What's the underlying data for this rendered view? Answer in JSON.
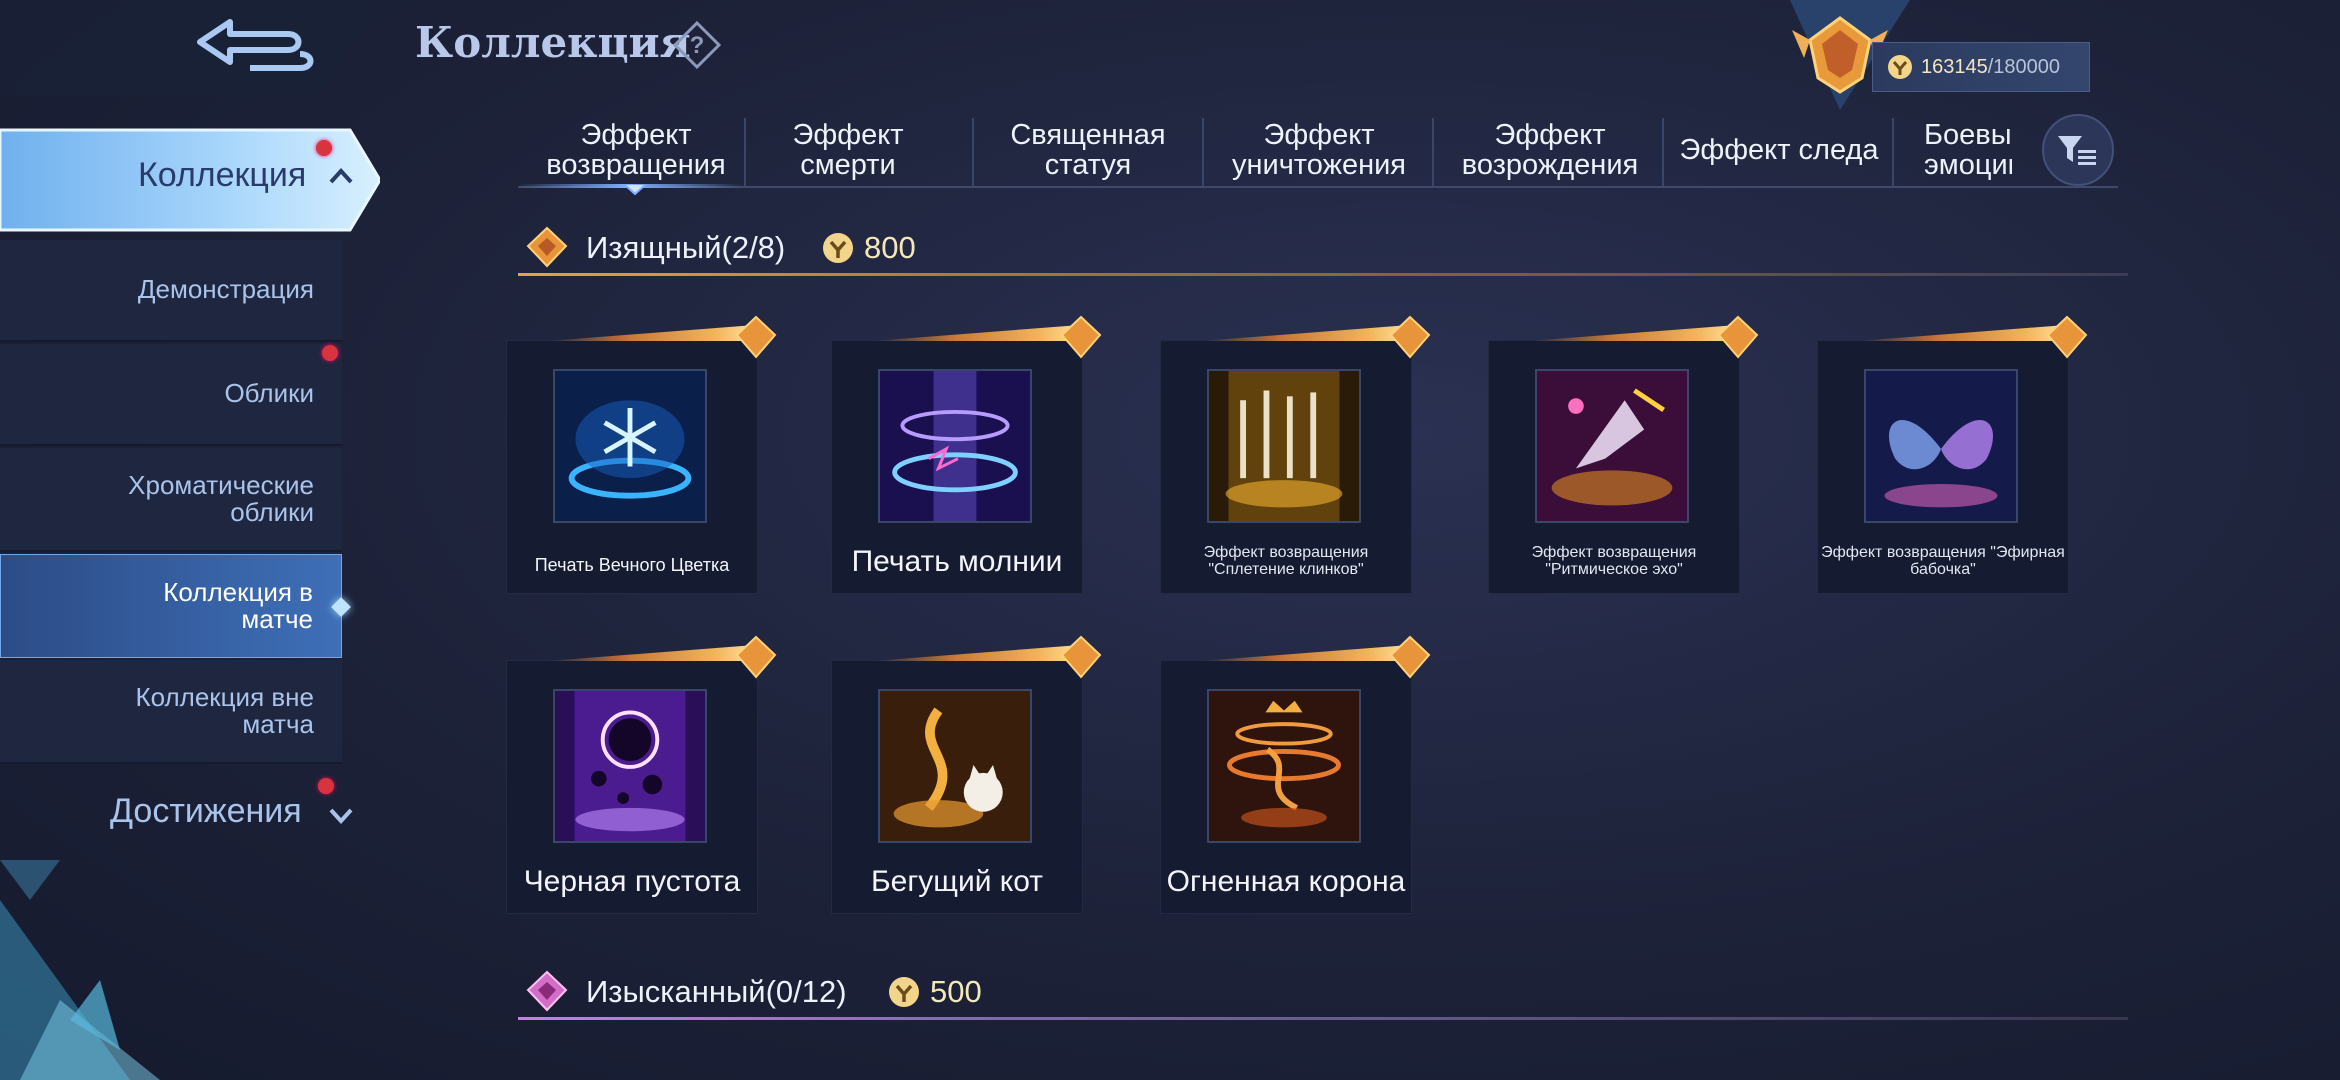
{
  "header": {
    "title": "Коллекция",
    "points_current": "163145",
    "points_total": "/180000"
  },
  "sidebar": {
    "main": {
      "label": "Коллекция",
      "has_dot": true
    },
    "items": [
      {
        "label": "Демонстрация",
        "active": false,
        "dot": false
      },
      {
        "label": "Облики",
        "active": false,
        "dot": true
      },
      {
        "label": "Хроматические облики",
        "active": false,
        "dot": false
      },
      {
        "label": "Коллекция в матче",
        "active": true,
        "dot": false
      },
      {
        "label": "Коллекция вне матча",
        "active": false,
        "dot": false
      }
    ],
    "achievements": {
      "label": "Достижения",
      "has_dot": true
    }
  },
  "tabs": [
    {
      "label": "Эффект возвращения",
      "selected": true
    },
    {
      "label": "Эффект смерти",
      "selected": false
    },
    {
      "label": "Священная статуя",
      "selected": false
    },
    {
      "label": "Эффект уничтожения",
      "selected": false
    },
    {
      "label": "Эффект возрождения",
      "selected": false
    },
    {
      "label": "Эффект следа",
      "selected": false
    },
    {
      "label": "Боевые эмоции",
      "selected": false
    }
  ],
  "sections": [
    {
      "label": "Изящный(2/8)",
      "price": "800",
      "cards": [
        {
          "name": "Печать Вечного Цветка",
          "icon": "snowflake-seal-icon"
        },
        {
          "name": "Печать молнии",
          "icon": "lightning-seal-icon"
        },
        {
          "name": "Эффект возвращения \"Сплетение клинков\"",
          "icon": "blades-icon"
        },
        {
          "name": "Эффект возвращения \"Ритмическое эхо\"",
          "icon": "rhythm-echo-icon"
        },
        {
          "name": "Эффект возвращения \"Эфирная бабочка\"",
          "icon": "butterfly-icon"
        },
        {
          "name": "Черная пустота",
          "icon": "black-void-icon"
        },
        {
          "name": "Бегущий кот",
          "icon": "running-cat-icon"
        },
        {
          "name": "Огненная корона",
          "icon": "fire-crown-icon"
        }
      ]
    },
    {
      "label": "Изысканный(0/12)",
      "price": "500"
    }
  ],
  "colors": {
    "background": "#1d2239",
    "accent_gold": "#e7a243",
    "sidebar_active": "#3e6fb8",
    "red_dot": "#d8343e"
  }
}
